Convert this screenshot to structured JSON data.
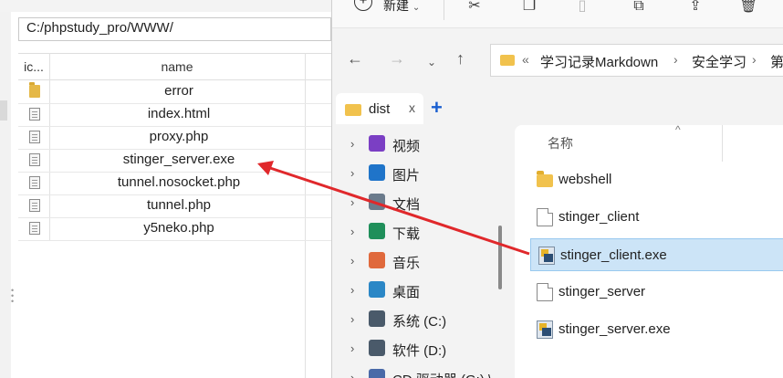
{
  "file_manager": {
    "path": "C:/phpstudy_pro/WWW/",
    "columns": {
      "icon": "ic...",
      "name": "name"
    },
    "files": [
      {
        "name": "error",
        "type": "folder"
      },
      {
        "name": "index.html",
        "type": "file"
      },
      {
        "name": "proxy.php",
        "type": "file"
      },
      {
        "name": "stinger_server.exe",
        "type": "file"
      },
      {
        "name": "tunnel.nosocket.php",
        "type": "file"
      },
      {
        "name": "tunnel.php",
        "type": "file"
      },
      {
        "name": "y5neko.php",
        "type": "file"
      }
    ]
  },
  "explorer": {
    "toolbar": {
      "new_label": "新建"
    },
    "address": {
      "overflow": "«",
      "crumbs": [
        "学习记录Markdown",
        "安全学习",
        "第"
      ]
    },
    "tab": {
      "label": "dist",
      "close": "x",
      "new_tab": "+"
    },
    "nav_items": [
      {
        "label": "视频",
        "icon": "video-icon",
        "color": "#7b3fc4"
      },
      {
        "label": "图片",
        "icon": "pictures-icon",
        "color": "#1f74c9"
      },
      {
        "label": "文档",
        "icon": "documents-icon",
        "color": "#6b7b8c"
      },
      {
        "label": "下载",
        "icon": "download-icon",
        "color": "#1f8f5a"
      },
      {
        "label": "音乐",
        "icon": "music-icon",
        "color": "#e0693c"
      },
      {
        "label": "桌面",
        "icon": "desktop-icon",
        "color": "#2b87c6"
      },
      {
        "label": "系统 (C:)",
        "icon": "drive-icon",
        "color": "#4a5a6a"
      },
      {
        "label": "软件 (D:)",
        "icon": "drive-icon",
        "color": "#4a5a6a"
      },
      {
        "label": "CD 驱动器 (G:) \\",
        "icon": "cd-drive-icon",
        "color": "#4a6aa8"
      }
    ],
    "content_header": {
      "name": "名称"
    },
    "items": [
      {
        "name": "webshell",
        "type": "folder"
      },
      {
        "name": "stinger_client",
        "type": "file"
      },
      {
        "name": "stinger_client.exe",
        "type": "exe",
        "selected": true
      },
      {
        "name": "stinger_server",
        "type": "file"
      },
      {
        "name": "stinger_server.exe",
        "type": "exe"
      }
    ]
  },
  "annotation": {
    "arrow_color": "#e0282b"
  }
}
